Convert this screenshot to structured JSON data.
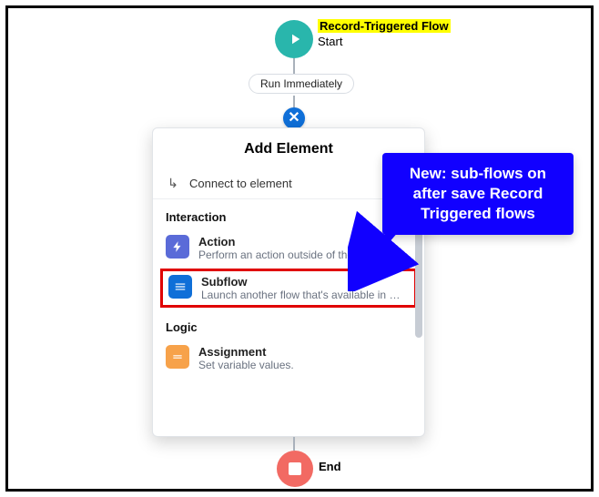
{
  "start": {
    "title": "Record-Triggered Flow",
    "sub": "Start",
    "timing": "Run Immediately",
    "add_symbol": "✕"
  },
  "popover": {
    "title": "Add Element",
    "connect": "Connect to element",
    "sections": {
      "interaction": "Interaction",
      "logic": "Logic"
    },
    "items": {
      "action": {
        "title": "Action",
        "desc": "Perform an action outside of the flow. C…"
      },
      "subflow": {
        "title": "Subflow",
        "desc": "Launch another flow that's available in y…"
      },
      "assignment": {
        "title": "Assignment",
        "desc": "Set variable values."
      }
    }
  },
  "end": {
    "label": "End"
  },
  "callout": {
    "text": "New: sub-flows on after save Record Triggered flows"
  }
}
